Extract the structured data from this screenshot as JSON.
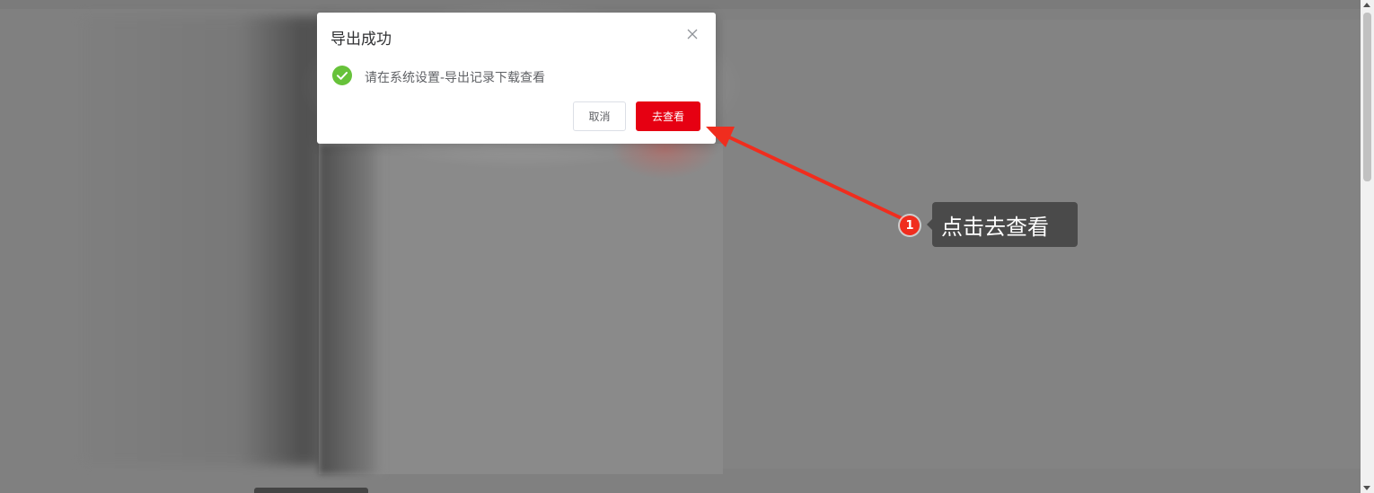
{
  "dialog": {
    "title": "导出成功",
    "message": "请在系统设置-导出记录下载查看",
    "cancel_label": "取消",
    "confirm_label": "去查看",
    "close_icon": "close-icon",
    "status_icon": "check-circle-icon"
  },
  "annotation": {
    "step_number": "1",
    "tooltip_text": "点击去查看"
  },
  "colors": {
    "primary": "#e60012",
    "success": "#67c23a",
    "annotation_red": "#f02d1e",
    "tooltip_bg": "#4a4a4a"
  }
}
